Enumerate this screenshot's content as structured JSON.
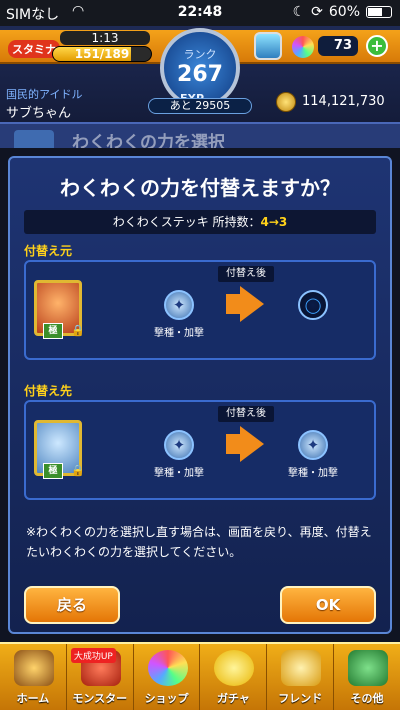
{
  "status": {
    "carrier": "SIMなし",
    "time": "22:48",
    "battery": "60%"
  },
  "hud": {
    "stamina_label": "スタミナ",
    "stamina_timer": "1:13",
    "stamina": "151/189",
    "stamina_fraction": 0.799,
    "rank_label": "ランク",
    "rank": "267",
    "exp_label": "EXP",
    "exp_remaining": "あと 29505",
    "orb_count": "73",
    "title": "国民的アイドル",
    "player_name": "サブちゃん",
    "coins": "114,121,730"
  },
  "underlay": {
    "title": "わくわくの力を選択"
  },
  "dialog": {
    "title": "わくわくの力を付替えますか？",
    "sticker_text": "わくわくステッキ 所持数：",
    "sticker_change": "4→3",
    "source_label": "付替え元",
    "target_label": "付替え先",
    "after_tag": "付替え後",
    "source_ability": "撃種・加撃",
    "target_ability_before": "撃種・加撃",
    "target_ability_after": "撃種・加撃",
    "kiwa": "極",
    "note": "※わくわくの力を選択し直す場合は、画面を戻り、再度、付替えたいわくわくの力を選択してください。",
    "back_button": "戻る",
    "ok_button": "OK"
  },
  "nav": {
    "items": [
      {
        "label": "ホーム"
      },
      {
        "label": "モンスター",
        "badge": "大成功UP"
      },
      {
        "label": "ショップ"
      },
      {
        "label": "ガチャ"
      },
      {
        "label": "フレンド"
      },
      {
        "label": "その他"
      }
    ]
  }
}
